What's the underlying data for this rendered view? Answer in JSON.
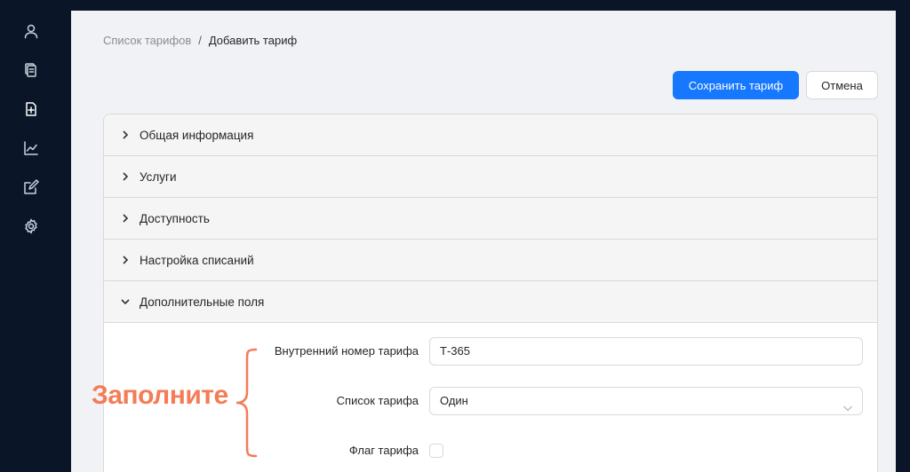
{
  "sidebar": {
    "items": [
      {
        "icon": "user-icon"
      },
      {
        "icon": "copy-documents-icon"
      },
      {
        "icon": "document-add-icon",
        "active": true
      },
      {
        "icon": "line-chart-icon"
      },
      {
        "icon": "edit-square-icon"
      },
      {
        "icon": "gear-icon"
      }
    ]
  },
  "breadcrumb": {
    "parent": "Список тарифов",
    "separator": "/",
    "current": "Добавить тариф"
  },
  "actions": {
    "save_label": "Сохранить тариф",
    "cancel_label": "Отмена",
    "primary_color": "#1677ff"
  },
  "panels": [
    {
      "label": "Общая информация",
      "expanded": false
    },
    {
      "label": "Услуги",
      "expanded": false
    },
    {
      "label": "Доступность",
      "expanded": false
    },
    {
      "label": "Настройка списаний",
      "expanded": false
    },
    {
      "label": "Дополнительные поля",
      "expanded": true
    }
  ],
  "form": {
    "internal_number_label": "Внутренний номер тарифа",
    "internal_number_value": "Т-365",
    "tariff_list_label": "Список тарифа",
    "tariff_list_value": "Один",
    "tariff_flag_label": "Флаг тарифа",
    "tariff_flag_checked": false
  },
  "annotation": {
    "text": "Заполните",
    "color": "#f47c57"
  }
}
